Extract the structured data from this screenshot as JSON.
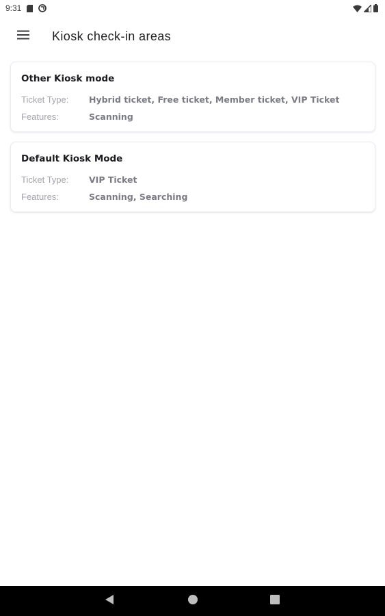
{
  "status_bar": {
    "time": "9:31",
    "left_icons": [
      "sd-card-icon",
      "sync-icon"
    ],
    "right_icons": [
      "wifi-icon",
      "signal-icon",
      "battery-icon"
    ]
  },
  "app_bar": {
    "menu_icon": "hamburger-menu-icon",
    "title": "Kiosk check-in areas"
  },
  "cards": [
    {
      "title": "Other Kiosk mode",
      "ticket_type_label": "Ticket Type:",
      "ticket_type_value": "Hybrid ticket, Free ticket, Member ticket, VIP Ticket",
      "features_label": "Features:",
      "features_value": "Scanning"
    },
    {
      "title": "Default Kiosk Mode",
      "ticket_type_label": "Ticket Type:",
      "ticket_type_value": "VIP Ticket",
      "features_label": "Features:",
      "features_value": "Scanning, Searching"
    }
  ],
  "nav_bar": {
    "buttons": [
      "back-triangle-icon",
      "home-circle-icon",
      "recents-square-icon"
    ]
  },
  "colors": {
    "background": "#ffffff",
    "nav_bar": "#000000",
    "label": "#a3a3ab",
    "value": "#7b7b85"
  }
}
